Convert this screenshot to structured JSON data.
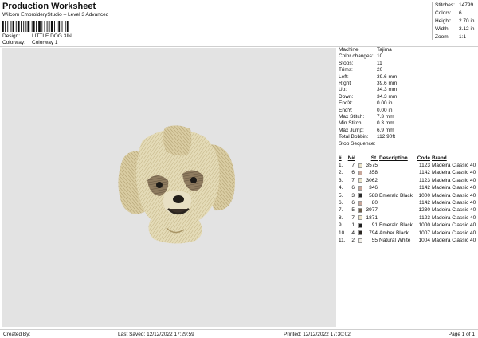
{
  "header": {
    "title": "Production Worksheet",
    "subtitle": "Wilcom EmbroideryStudio – Level 3 Advanced",
    "design_label": "Design:",
    "design_value": "LITTLE DOG 3IN",
    "colorway_label": "Colorway:",
    "colorway_value": "Colorway 1"
  },
  "summary": {
    "stitches_label": "Stitches:",
    "stitches": "14799",
    "colors_label": "Colors:",
    "colors": "6",
    "height_label": "Height:",
    "height": "2.70 in",
    "width_label": "Width:",
    "width": "3.12 in",
    "zoom_label": "Zoom:",
    "zoom": "1:1"
  },
  "machine_info": [
    {
      "label": "Machine:",
      "value": "Tajima"
    },
    {
      "label": "Color changes:",
      "value": "10"
    },
    {
      "label": "Stops:",
      "value": "11"
    },
    {
      "label": "Trims:",
      "value": "20"
    },
    {
      "label": "Left:",
      "value": "39.6 mm"
    },
    {
      "label": "Right",
      "value": "39.6 mm"
    },
    {
      "label": "Up:",
      "value": "34.3 mm"
    },
    {
      "label": "Down:",
      "value": "34.3 mm"
    },
    {
      "label": "EndX:",
      "value": "0.00 in"
    },
    {
      "label": "EndY:",
      "value": "0.00 in"
    },
    {
      "label": "Max Stitch:",
      "value": "7.3 mm"
    },
    {
      "label": "Min Stitch:",
      "value": "0.3 mm"
    },
    {
      "label": "Max Jump:",
      "value": "6.9 mm"
    },
    {
      "label": "Total Bobbin:",
      "value": "112.90ft"
    }
  ],
  "stop_sequence": {
    "title": "Stop Sequence:",
    "headers": [
      "#",
      "N#",
      "",
      "St.",
      "Description",
      "Code",
      "Brand"
    ],
    "rows": [
      {
        "num": "1.",
        "needle": "7",
        "color": "#ece4c8",
        "stitches": "3575",
        "desc": "",
        "code": "1123",
        "brand": "Madeira Classic 40"
      },
      {
        "num": "2.",
        "needle": "6",
        "color": "#c9a79a",
        "stitches": "358",
        "desc": "",
        "code": "1142",
        "brand": "Madeira Classic 40"
      },
      {
        "num": "3.",
        "needle": "7",
        "color": "#ece4c8",
        "stitches": "3062",
        "desc": "",
        "code": "1123",
        "brand": "Madeira Classic 40"
      },
      {
        "num": "4.",
        "needle": "6",
        "color": "#c9a79a",
        "stitches": "346",
        "desc": "",
        "code": "1142",
        "brand": "Madeira Classic 40"
      },
      {
        "num": "5.",
        "needle": "3",
        "color": "#2a2a2a",
        "stitches": "588",
        "desc": "Emerald Black",
        "code": "1000",
        "brand": "Madeira Classic 40"
      },
      {
        "num": "6.",
        "needle": "6",
        "color": "#c9a79a",
        "stitches": "80",
        "desc": "",
        "code": "1142",
        "brand": "Madeira Classic 40"
      },
      {
        "num": "7.",
        "needle": "5",
        "color": "#6d5f4c",
        "stitches": "3977",
        "desc": "",
        "code": "1230",
        "brand": "Madeira Classic 40"
      },
      {
        "num": "8.",
        "needle": "7",
        "color": "#ece4c8",
        "stitches": "1871",
        "desc": "",
        "code": "1123",
        "brand": "Madeira Classic 40"
      },
      {
        "num": "9.",
        "needle": "1",
        "color": "#1e1e1e",
        "stitches": "91",
        "desc": "Emerald Black",
        "code": "1000",
        "brand": "Madeira Classic 40"
      },
      {
        "num": "10.",
        "needle": "4",
        "color": "#2b2621",
        "stitches": "794",
        "desc": "Amber Black",
        "code": "1007",
        "brand": "Madeira Classic 40"
      },
      {
        "num": "11.",
        "needle": "2",
        "color": "#f4f1ea",
        "stitches": "55",
        "desc": "Natural White",
        "code": "1004",
        "brand": "Madeira Classic 40"
      }
    ]
  },
  "footer": {
    "created_by": "Created By:",
    "last_saved": "Last Saved: 12/12/2022 17:29:59",
    "printed": "Printed: 12/12/2022 17:30:02",
    "page": "Page 1 of 1"
  },
  "colors": {
    "preview_bg": "#e3e3e3",
    "thread_light": "#ece4c8",
    "thread_mid": "#c9b88d",
    "thread_brown": "#6d5f4c"
  }
}
